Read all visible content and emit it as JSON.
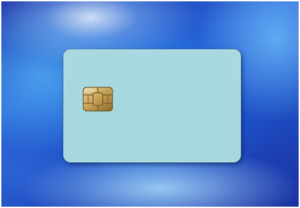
{
  "scene": {
    "description_colors": {
      "background_dark": "#1a2fa6",
      "background_light": "#b4e6ff",
      "card_fill": "#a9d9e0",
      "chip_gold": "#c9a45a"
    },
    "card": {
      "icon": "chip-icon"
    }
  }
}
